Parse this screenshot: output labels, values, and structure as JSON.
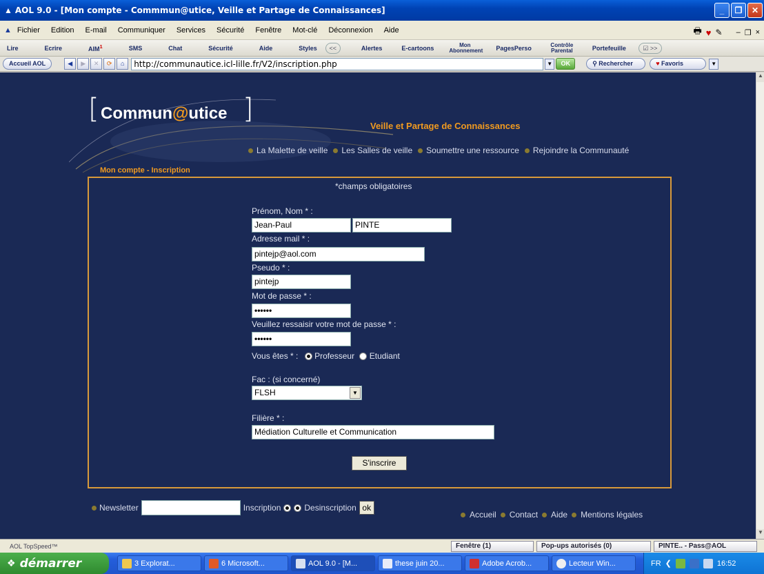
{
  "window": {
    "title": "AOL 9.0 - [Mon compte - Commmun@utice, Veille et Partage de Connaissances]"
  },
  "menu": [
    "Fichier",
    "Edition",
    "E-mail",
    "Communiquer",
    "Services",
    "Sécurité",
    "Fenêtre",
    "Mot-clé",
    "Déconnexion",
    "Aide"
  ],
  "aol_toolbar": [
    "Lire",
    "Ecrire",
    "AIM",
    "SMS",
    "Chat",
    "Sécurité",
    "Aide",
    "Styles",
    "Alertes",
    "E-cartoons",
    "Mon Abonnement",
    "PagesPerso",
    "Contrôle Parental",
    "Portefeuille"
  ],
  "aim_badge": "1",
  "address_bar": {
    "home_label": "Accueil AOL",
    "url": "http://communautice.icl-lille.fr/V2/inscription.php",
    "ok_label": "OK",
    "search_label": "Rechercher",
    "favorites_label": "Favoris"
  },
  "site": {
    "logo_pre": "Commun",
    "logo_at": "@",
    "logo_post": "utice",
    "tagline": "Veille et Partage de Connaissances",
    "nav": [
      "La Malette de veille",
      "Les Salles de veille",
      "Soumettre une ressource",
      "Rejoindre la Communauté"
    ],
    "section_title": "Mon compte - Inscription"
  },
  "form": {
    "required_note": "*champs obligatoires",
    "name_label": "Prénom, Nom * :",
    "first_name": "Jean-Paul",
    "last_name": "PINTE",
    "email_label": "Adresse mail * :",
    "email": "pintejp@aol.com",
    "pseudo_label": "Pseudo * :",
    "pseudo": "pintejp",
    "password_label": "Mot de passe * :",
    "password": "••••••",
    "password2_label": "Veuillez ressaisir votre mot de passe * :",
    "password2": "••••••",
    "role_label": "Vous êtes * :",
    "role_professor": "Professeur",
    "role_student": "Etudiant",
    "fac_label": "Fac : (si concerné)",
    "fac_value": "FLSH",
    "filiere_label": "Filière * :",
    "filiere": "Médiation Culturelle et Communication",
    "submit": "S'inscrire"
  },
  "footer": {
    "newsletter_label": "Newsletter",
    "inscription": "Inscription",
    "desinscription": "Desinscription",
    "ok": "ok",
    "links": [
      "Accueil",
      "Contact",
      "Aide",
      "Mentions légales"
    ]
  },
  "statusbar": {
    "left": "AOL TopSpeed™",
    "fenetre": "Fenêtre (1)",
    "popups": "Pop-ups autorisés (0)",
    "pass": "PINTE.. - Pass@AOL"
  },
  "taskbar": {
    "start": "démarrer",
    "tasks": [
      "3 Explorat...",
      "6 Microsoft...",
      "AOL 9.0 - [M...",
      "these juin 20...",
      "Adobe Acrob...",
      "Lecteur Win..."
    ],
    "lang": "FR",
    "time": "16:52"
  }
}
